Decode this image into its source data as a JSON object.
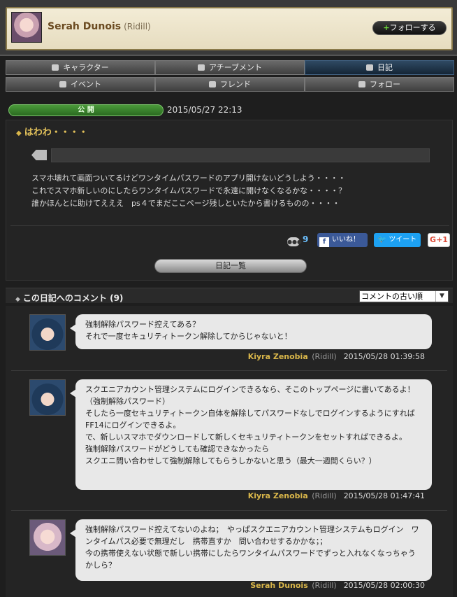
{
  "profile": {
    "name": "Serah Dunois",
    "world": "(Ridill)",
    "follow_label": "フォローする",
    "follow_plus": "+"
  },
  "tabs": [
    {
      "label": "キャラクター",
      "icon": "character-icon",
      "active": false
    },
    {
      "label": "アチーブメント",
      "icon": "achievement-icon",
      "active": false
    },
    {
      "label": "日記",
      "icon": "diary-icon",
      "active": true
    },
    {
      "label": "イベント",
      "icon": "event-icon",
      "active": false
    },
    {
      "label": "フレンド",
      "icon": "friend-icon",
      "active": false
    },
    {
      "label": "フォロー",
      "icon": "follow-icon",
      "active": false
    }
  ],
  "diary": {
    "status": "公 開",
    "date": "2015/05/27 22:13",
    "title": "はわわ・・・・",
    "title_marker": "◆",
    "body": [
      "スマホ壊れて画面ついてるけどワンタイムパスワードのアプリ開けないどうしよう・・・・",
      "これでスマホ新しいのにしたらワンタイムパスワードで永遠に開けなくなるかな・・・・？",
      "誰かほんとに助けてえええ　ps４でまだここページ残しといたから書けるものの・・・・"
    ],
    "comment_count": "9",
    "like_label": "いいね！",
    "like_icon": "f",
    "tweet_label": "ツイート",
    "gplus_label": "G+1",
    "list_button": "日記一覧"
  },
  "comments_header": {
    "title": "この日記へのコメント (9)",
    "marker": "◆",
    "sort_selected": "コメントの古い順",
    "sort_arrow": "▼"
  },
  "comments": [
    {
      "avatar": "kiyra",
      "lines": [
        "強制解除パスワード控えてある？",
        "それで一度セキュリティトークン解除してからじゃないと！"
      ],
      "author": "Kiyra Zenobia",
      "world": "(Ridill)",
      "date": "2015/05/28 01:39:58"
    },
    {
      "avatar": "kiyra",
      "lines": [
        "スクエニアカウント管理システムにログインできるなら、そこのトップページに書いてあるよ！（強制解除パスワード）",
        "そしたら一度セキュリティトークン自体を解除してパスワードなしでログインするようにすればFF14にログインできるよ。",
        "で、新しいスマホでダウンロードして新しくセキュリティトークンをセットすればできるよ。",
        "強制解除パスワードがどうしても確認できなかったら",
        "スクエニ問い合わせして強制解除してもらうしかないと思う（最大一週間くらい？）"
      ],
      "author": "Kiyra Zenobia",
      "world": "(Ridill)",
      "date": "2015/05/28 01:47:41"
    },
    {
      "avatar": "serah",
      "lines": [
        "強制解除パスワード控えてないのよね；　やっぱスクエニアカウント管理システムもログイン　ワンタイムパス必要で無理だし　携帯直すか　問い合わせするかかな；；",
        "今の携帯使えない状態で新しい携帯にしたらワンタイムパスワードでずっと入れなくなっちゃうかしら？"
      ],
      "author": "Serah Dunois",
      "world": "(Ridill)",
      "date": "2015/05/28 02:00:30"
    }
  ]
}
